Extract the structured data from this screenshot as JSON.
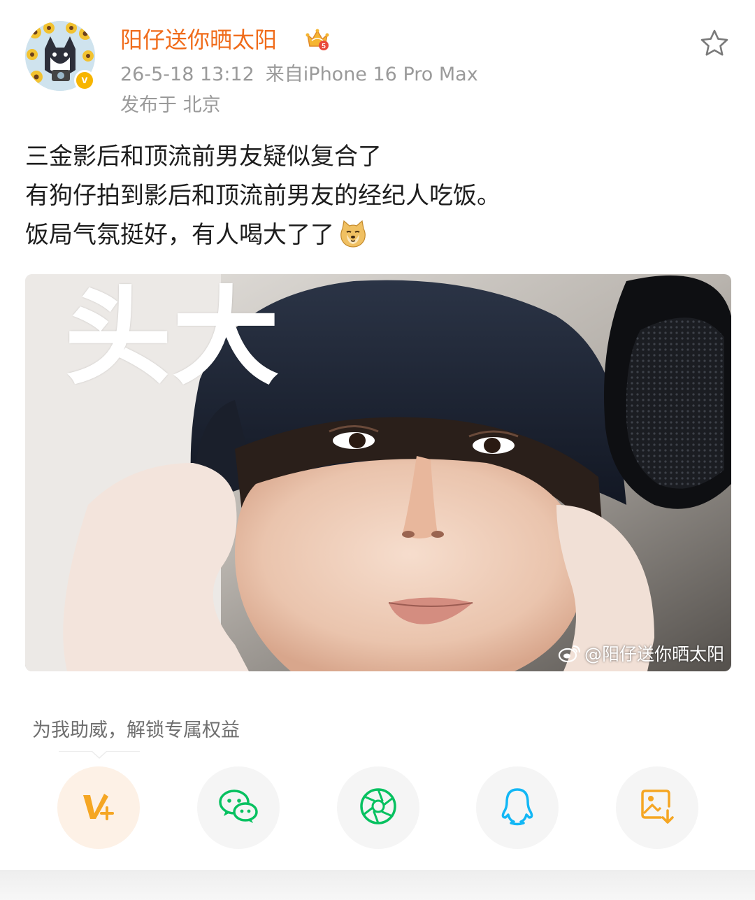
{
  "header": {
    "username": "阳仔送你晒太阳",
    "verified_badge": "v",
    "crown_level": "5",
    "timestamp": "26-5-18 13:12",
    "source": "来自iPhone 16 Pro Max",
    "location": "发布于 北京",
    "favorite_icon": "star-outline-icon"
  },
  "post": {
    "lines": [
      "三金影后和顶流前男友疑似复合了",
      "有狗仔拍到影后和顶流前男友的经纪人吃饭。",
      "饭局气氛挺好，有人喝大了了"
    ],
    "emoji": "doge-emoji"
  },
  "image": {
    "caption": "头大",
    "watermark": "@阳仔送你晒太阳"
  },
  "boost": {
    "text": "为我助威，解锁专属权益"
  },
  "share": {
    "items": [
      {
        "icon": "vplus-icon",
        "color": "#f5a623"
      },
      {
        "icon": "wechat-icon",
        "color": "#07c160"
      },
      {
        "icon": "moments-icon",
        "color": "#07c160"
      },
      {
        "icon": "qq-icon",
        "color": "#12b7f5"
      },
      {
        "icon": "save-image-icon",
        "color": "#f5a623"
      }
    ]
  },
  "colors": {
    "username": "#f06c1b",
    "meta": "#9a9a9a",
    "verified": "#f7b500"
  }
}
